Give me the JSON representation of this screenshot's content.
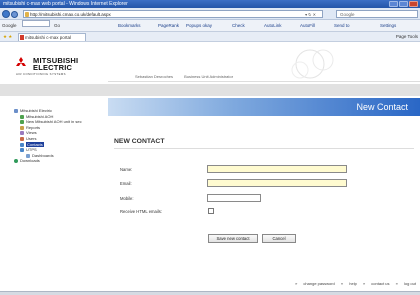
{
  "browser": {
    "title": "mitsubishi c-max web portal - Windows Internet Explorer",
    "url": "http://mitsubishi.cmax.co.uk/default.aspx",
    "search_placeholder": "Google",
    "toolbar": {
      "google_label": "Google",
      "go": "Go",
      "bookmarks": "Bookmarks",
      "pagerank": "PageRank",
      "popups": "Popups okay",
      "check": "Check",
      "autolink": "AutoLink",
      "autofill": "AutoFill",
      "sendto": "Send to",
      "settings": "Settings"
    },
    "tab_label": "mitsubishi c-max portal",
    "fav_right": "Page   Tools"
  },
  "header": {
    "logo_line1": "MITSUBISHI",
    "logo_line2": "ELECTRIC",
    "logo_line3": "AIR CONDITIONING SYSTEMS",
    "nav_user": "Sebastian Desroches",
    "nav_role": "Business Unit Administrator"
  },
  "banner": {
    "title": "New Contact"
  },
  "sidebar": {
    "items": [
      {
        "label": "Mitsubishi Electric",
        "indent": 0
      },
      {
        "label": "Mitsubishi AOH",
        "indent": 1
      },
      {
        "label": "New Mitsubishi AOH unit in sec",
        "indent": 1
      },
      {
        "label": "Reports",
        "indent": 1
      },
      {
        "label": "Views",
        "indent": 1
      },
      {
        "label": "Users",
        "indent": 1
      },
      {
        "label": "Contacts",
        "indent": 1,
        "selected": true
      },
      {
        "label": "UTPS",
        "indent": 1
      },
      {
        "label": "Dashboards",
        "indent": 2
      },
      {
        "label": "Downloads",
        "indent": 0
      }
    ]
  },
  "form": {
    "title": "NEW CONTACT",
    "name_label": "Name:",
    "email_label": "Email:",
    "mobile_label": "Mobile:",
    "html_label": "Receive HTML emails:",
    "name_value": "",
    "email_value": "",
    "mobile_value": "",
    "save_label": "Save new contact",
    "cancel_label": "Cancel"
  },
  "footer": {
    "change_password": "change password",
    "help": "help",
    "contact_us": "contact us",
    "log_out": "log out"
  },
  "colors": {
    "banner_blue": "#2a67c6",
    "field_yellow": "#fffbd0",
    "selected_nav": "#1d3f9b"
  }
}
